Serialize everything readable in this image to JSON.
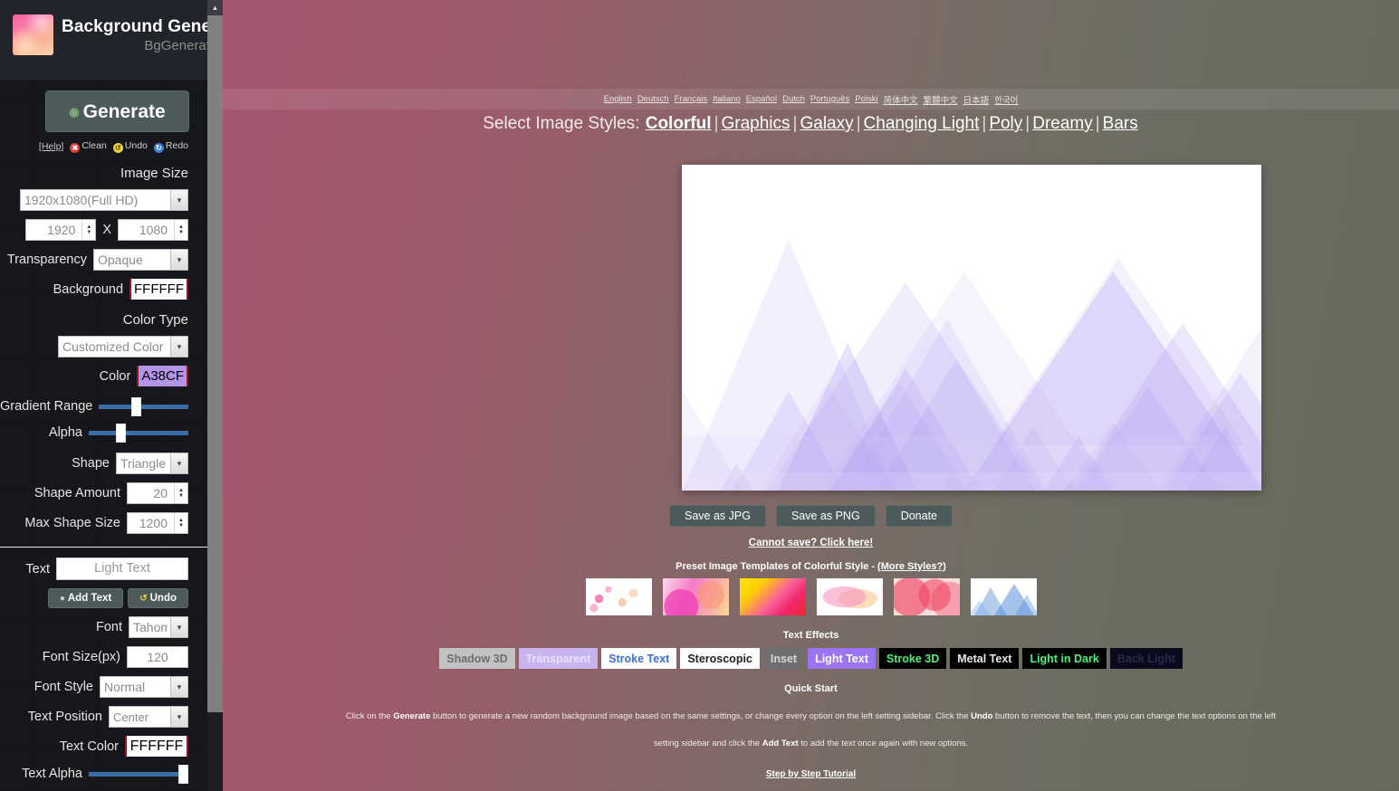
{
  "sidebar": {
    "app_title": "Background Generator",
    "app_subtitle": "BgGenerator.com",
    "generate_label": "Generate",
    "help_label": "[Help]",
    "clean_label": "Clean",
    "undo_label": "Undo",
    "redo_label": "Redo",
    "image_size_label": "Image Size",
    "image_size_value": "1920x1080(Full HD)",
    "width_value": "1920",
    "x_label": "X",
    "height_value": "1080",
    "transparency_label": "Transparency",
    "transparency_value": "Opaque",
    "background_label": "Background",
    "background_value": "FFFFFF",
    "color_type_label": "Color Type",
    "color_type_value": "Customized Color",
    "color_label": "Color",
    "color_value": "A38CF",
    "gradient_range_label": "Gradient Range",
    "alpha_label": "Alpha",
    "shape_label": "Shape",
    "shape_value": "Triangle",
    "shape_amount_label": "Shape Amount",
    "shape_amount_value": "20",
    "max_shape_size_label": "Max Shape Size",
    "max_shape_size_value": "1200",
    "text_label": "Text",
    "text_value": "Light Text",
    "add_text_label": "Add Text",
    "text_undo_label": "Undo",
    "font_label": "Font",
    "font_value": "Tahom",
    "font_size_label": "Font Size(px)",
    "font_size_value": "120",
    "font_style_label": "Font Style",
    "font_style_value": "Normal",
    "text_position_label": "Text Position",
    "text_position_value": "Center",
    "text_color_label": "Text Color",
    "text_color_value": "FFFFFF",
    "text_alpha_label": "Text Alpha"
  },
  "languages": [
    "English",
    "Deutsch",
    "Français",
    "Italiano",
    "Español",
    "Dutch",
    "Português",
    "Polski",
    "简体中文",
    "繁體中文",
    "日本語",
    "한국어"
  ],
  "styles": {
    "lead": "Select Image Styles:",
    "items": [
      {
        "label": "Colorful",
        "active": true
      },
      {
        "label": "Graphics",
        "active": false
      },
      {
        "label": "Galaxy",
        "active": false
      },
      {
        "label": "Changing Light",
        "active": false
      },
      {
        "label": "Poly",
        "active": false
      },
      {
        "label": "Dreamy",
        "active": false
      },
      {
        "label": "Bars",
        "active": false
      }
    ]
  },
  "actions": {
    "save_jpg": "Save as JPG",
    "save_png": "Save as PNG",
    "donate": "Donate",
    "cannot_save": "Cannot save? Click here!"
  },
  "presets": {
    "title": "Preset Image Templates of Colorful Style - ",
    "more_styles": "(More Styles?)",
    "thumbs": [
      {
        "name": "petals-pink",
        "css": "radial-gradient(circle at 20% 55%, rgba(240,90,160,0.75) 0 7%, transparent 8%), radial-gradient(circle at 34% 30%, rgba(244,120,180,0.55) 0 6%, transparent 7%), radial-gradient(circle at 55% 65%, rgba(250,160,120,0.55) 0 9%, transparent 10%), radial-gradient(circle at 72% 40%, rgba(250,190,140,0.5) 0 8%, transparent 9%), radial-gradient(circle at 12% 80%, rgba(240,110,160,0.5) 0 6%, transparent 7%), #ffffff"
      },
      {
        "name": "magenta-bubbles",
        "css": "radial-gradient(circle at 28% 75%, rgba(240,60,180,0.75) 0 30%, transparent 32%), radial-gradient(circle at 72% 45%, rgba(250,150,120,0.6) 0 26%, transparent 28%), linear-gradient(110deg, #fbd9ea 0%, #f77bc8 40%, #f9d98f 100%)"
      },
      {
        "name": "yellow-red-gradient",
        "css": "linear-gradient(135deg, #ffe400 0%, #ffd000 25%, #f9609a 55%, #f2266b 75%, #ef2a2a 100%)"
      },
      {
        "name": "waves-pastel",
        "css": "radial-gradient(ellipse at 42% 50%, rgba(245,140,190,0.55) 0 38%, transparent 42%), radial-gradient(ellipse at 62% 55%, rgba(250,190,120,0.5) 0 32%, transparent 36%), #ffffff"
      },
      {
        "name": "red-circles",
        "css": "radial-gradient(circle at 25% 50%, rgba(240,70,100,0.65) 0 36%, transparent 38%), radial-gradient(circle at 62% 45%, rgba(240,70,100,0.6) 0 34%, transparent 36%), radial-gradient(circle at 85% 60%, rgba(245,110,130,0.55) 0 30%, transparent 32%), #f9dede"
      },
      {
        "name": "blue-triangles",
        "css": "#ffffff"
      }
    ]
  },
  "text_effects": {
    "title": "Text Effects",
    "items": [
      {
        "label": "Shadow 3D",
        "bg": "#c2c2c2",
        "fg": "#6d6d6d"
      },
      {
        "label": "Transparent",
        "bg": "#c9b4ef",
        "fg": "#e9e0fb"
      },
      {
        "label": "Stroke Text",
        "bg": "#ffffff",
        "fg": "#3f6fd4"
      },
      {
        "label": "Steroscopic",
        "bg": "#ffffff",
        "fg": "#222222"
      },
      {
        "label": "Inset",
        "bg": "#6f6f6f",
        "fg": "#d7d7d7"
      },
      {
        "label": "Light Text",
        "bg": "#9a74f5",
        "fg": "#ffffff"
      },
      {
        "label": "Stroke 3D",
        "bg": "#000000",
        "fg": "#4cf07c"
      },
      {
        "label": "Metal Text",
        "bg": "#000000",
        "fg": "#e8e8e8"
      },
      {
        "label": "Light in Dark",
        "bg": "#000000",
        "fg": "#4cf07c"
      },
      {
        "label": "Back Light",
        "bg": "#0a0a1e",
        "fg": "#2a2a4a"
      }
    ]
  },
  "quick_start": {
    "title": "Quick Start",
    "line1_a": "Click on the ",
    "line1_bold1": "Generate",
    "line1_b": " button to generate a new random background image based on the same settings, or change every option on the left setting sidebar. Click the ",
    "line1_bold2": "Undo",
    "line1_c": " button to remove the text, then you can change the text options on the left",
    "line2_a": "setting sidebar and click the ",
    "line2_bold": "Add Text",
    "line2_b": " to add the text once again with new options.",
    "tutorial_link": "Step by Step Tutorial"
  },
  "preview": {
    "name": "triangle-background-preview",
    "background": "#FFFFFF",
    "shape": "Triangle",
    "base_color": "#A38CF0"
  },
  "colors": {
    "accent_purple": "#A38CF0",
    "sidebar_bg": "#15171C",
    "button_bg": "#4C5A5A"
  }
}
